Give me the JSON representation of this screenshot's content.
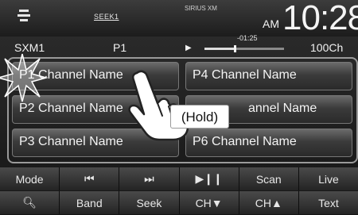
{
  "status": {
    "seek_label": "SEEK1",
    "sirius_logo": "SIRIUS XM",
    "ampm": "AM",
    "clock": "10:28"
  },
  "info": {
    "band": "SXM1",
    "preset": "P1",
    "play_icon": "play-icon",
    "elapsed": "-01:25",
    "progress_fraction": 0.38,
    "channel_count": "100Ch"
  },
  "presets": [
    {
      "label": "P1 Channel Name"
    },
    {
      "label": "P2 Channel Name"
    },
    {
      "label": "P3 Channel Name"
    },
    {
      "label": "P4 Channel Name"
    },
    {
      "label": "P5 Channel Name",
      "visible_label": "annel Name"
    },
    {
      "label": "P6 Channel Name"
    }
  ],
  "keys_row1": [
    {
      "label": "Mode"
    },
    {
      "label": "⏮",
      "icon": "skip-back-icon"
    },
    {
      "label": "⏭",
      "icon": "skip-forward-icon"
    },
    {
      "label": "▶❙❙",
      "icon": "play-pause-icon"
    },
    {
      "label": "Scan"
    },
    {
      "label": "Live"
    }
  ],
  "keys_row2": [
    {
      "label": "🔍︎",
      "icon": "search-icon"
    },
    {
      "label": "Band"
    },
    {
      "label": "Seek"
    },
    {
      "label": "CH▼"
    },
    {
      "label": "CH▲"
    },
    {
      "label": "Text"
    }
  ],
  "overlay": {
    "hold_label": "(Hold)",
    "hand_icon": "pointing-hand-icon",
    "burst_icon": "touch-burst-icon"
  },
  "colors": {
    "screen_bg": "#1e1e1e",
    "button_text": "#f4f4f4",
    "panel_border": "#9a9a9a"
  }
}
